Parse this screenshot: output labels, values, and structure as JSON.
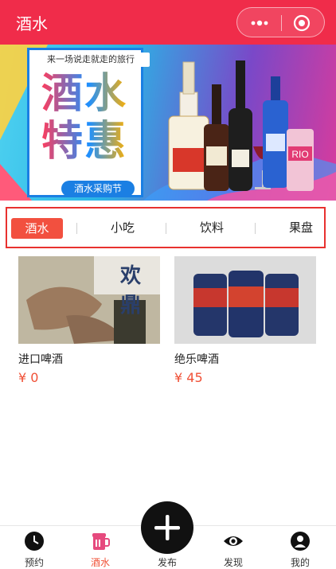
{
  "header": {
    "title": "酒水"
  },
  "capsule": {
    "more_icon": "more-dots-icon",
    "close_icon": "target-close-icon"
  },
  "banner": {
    "slogan": "来一场说走就走的旅行",
    "line1": "酒水",
    "line2": "特惠",
    "festival": "酒水采购节"
  },
  "tabs": [
    {
      "label": "酒水",
      "active": true
    },
    {
      "label": "小吃",
      "active": false
    },
    {
      "label": "饮料",
      "active": false
    },
    {
      "label": "果盘",
      "active": false
    }
  ],
  "products": [
    {
      "name": "进口啤酒",
      "price": "¥ 0",
      "image_text": "欢鼎"
    },
    {
      "name": "绝乐啤酒",
      "price": "¥ 45"
    }
  ],
  "bottom_nav": [
    {
      "label": "预约",
      "icon": "clock-icon",
      "active": false
    },
    {
      "label": "酒水",
      "icon": "cup-icon",
      "active": true
    },
    {
      "label": "发布",
      "icon": "plus-icon",
      "active": false
    },
    {
      "label": "发现",
      "icon": "eye-icon",
      "active": false
    },
    {
      "label": "我的",
      "icon": "user-icon",
      "active": false
    }
  ],
  "colors": {
    "header": "#f02c4a",
    "accent": "#f05036",
    "tab_border": "#e8312f"
  }
}
